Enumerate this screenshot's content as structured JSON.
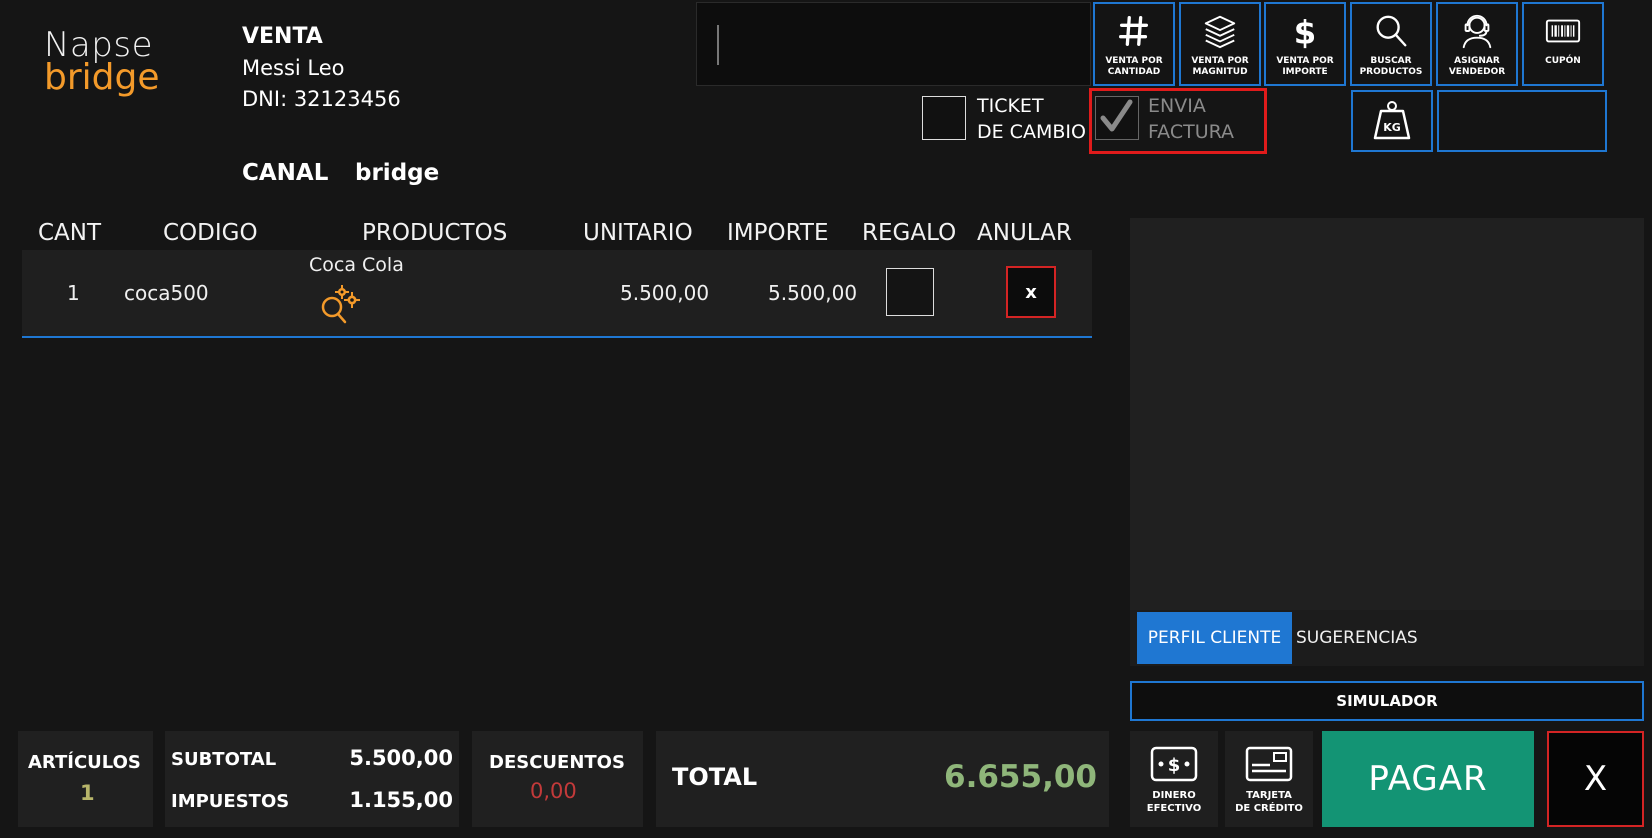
{
  "logo": {
    "line1": "Napse",
    "line2": "bridge"
  },
  "sale": {
    "title": "VENTA",
    "customer": "Messi Leo",
    "dni": "DNI: 32123456",
    "canal_label": "CANAL",
    "canal_value": "bridge"
  },
  "search": {
    "value": "",
    "placeholder": ""
  },
  "toolbar": [
    {
      "label": "VENTA POR\nCANTIDAD"
    },
    {
      "label": "VENTA POR\nMAGNITUD"
    },
    {
      "label": "VENTA POR\nIMPORTE"
    },
    {
      "label": "BUSCAR\nPRODUCTOS"
    },
    {
      "label": "ASIGNAR\nVENDEDOR"
    },
    {
      "label": "CUPÓN"
    }
  ],
  "kg_label": "KG",
  "options": {
    "ticket_cambio": "TICKET\nDE CAMBIO",
    "envia_factura": "ENVIA\nFACTURA"
  },
  "table": {
    "headers": [
      "CANT",
      "CODIGO",
      "PRODUCTOS",
      "UNITARIO",
      "IMPORTE",
      "REGALO",
      "ANULAR"
    ],
    "rows": [
      {
        "cant": "1",
        "codigo": "coca500",
        "producto": "Coca Cola",
        "unitario": "5.500,00",
        "importe": "5.500,00",
        "anular": "x"
      }
    ]
  },
  "tabs": {
    "perfil": "PERFIL CLIENTE",
    "sugerencias": "SUGERENCIAS"
  },
  "simulador": "SIMULADOR",
  "payments": {
    "efectivo": "DINERO\nEFECTIVO",
    "tarjeta": "TARJETA\nDE CRÉDITO",
    "pagar": "PAGAR",
    "close": "X"
  },
  "summary": {
    "articulos_label": "ARTÍCULOS",
    "articulos_value": "1",
    "subtotal_label": "SUBTOTAL",
    "subtotal_value": "5.500,00",
    "impuestos_label": "IMPUESTOS",
    "impuestos_value": "1.155,00",
    "descuentos_label": "DESCUENTOS",
    "descuentos_value": "0,00",
    "total_label": "TOTAL",
    "total_value": "6.655,00"
  },
  "colors": {
    "accent_blue": "#1f77d2",
    "danger_red": "#d42424",
    "pay_green": "#139474",
    "brand_orange": "#f39a2a",
    "total_green": "#8fb67a",
    "articulos_olive": "#b7b56a",
    "descuentos_red": "#c33a3a"
  },
  "icons": {
    "product_detail": "search-gear-icon",
    "toolbar": [
      "hash-icon",
      "layers-icon",
      "dollar-icon",
      "magnifier-icon",
      "headset-agent-icon",
      "barcode-icon"
    ],
    "kg": "weight-kg-icon",
    "efectivo": "cash-icon",
    "tarjeta": "credit-card-icon"
  }
}
